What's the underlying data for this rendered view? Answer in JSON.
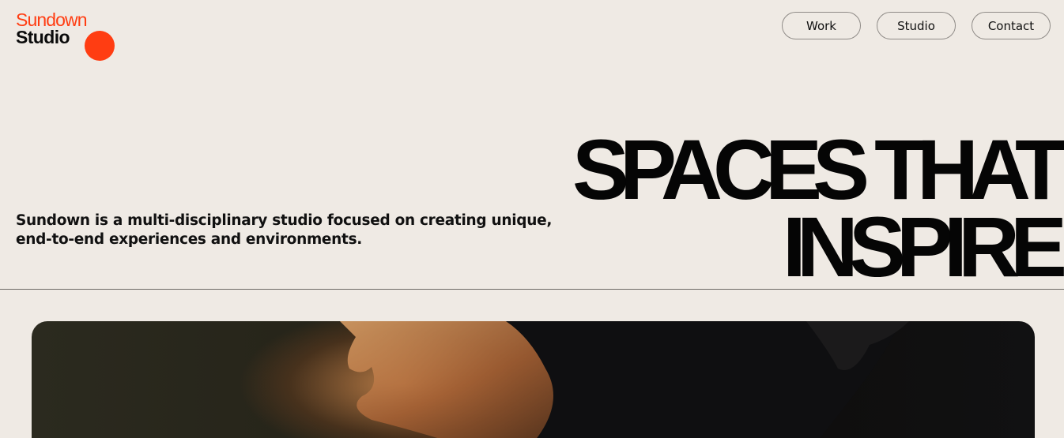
{
  "logo": {
    "line1": "Sundown",
    "line2": "Studio",
    "accent_color": "#ff3d12"
  },
  "nav": {
    "items": [
      {
        "label": "Work"
      },
      {
        "label": "Studio"
      },
      {
        "label": "Contact"
      }
    ]
  },
  "intro": {
    "text": "Sundown is a multi-disciplinary studio focused on creating unique, end-to-end experiences and environments."
  },
  "headline": {
    "line1": "SPACES THAT",
    "line2": "INSPIRE"
  },
  "hero": {
    "image": "portrait-photo",
    "description_icon": "face-profile-photo"
  },
  "colors": {
    "background": "#efeae4",
    "text": "#0b0b0b",
    "accent": "#ff3d12"
  }
}
